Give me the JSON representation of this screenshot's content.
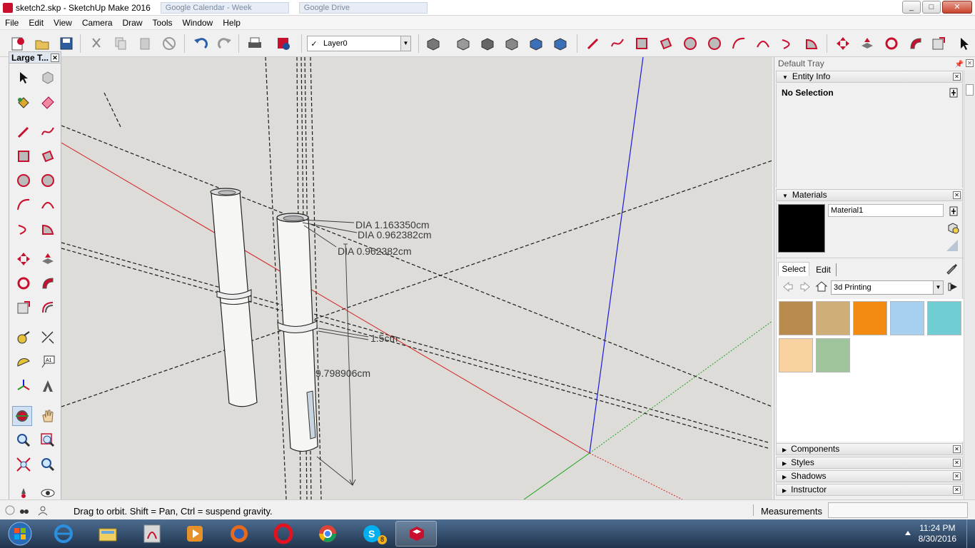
{
  "window": {
    "title": "sketch2.skp - SketchUp Make 2016",
    "ghost_tabs": [
      "Google Calendar - Week",
      "Google Drive"
    ],
    "min_glyph": "_",
    "max_glyph": "□",
    "close_glyph": "✕"
  },
  "menu": [
    "File",
    "Edit",
    "View",
    "Camera",
    "Draw",
    "Tools",
    "Window",
    "Help"
  ],
  "toolbar": {
    "layer_checked": "✓",
    "layer_value": "Layer0",
    "layer_arrow": "▼"
  },
  "palette": {
    "title": "Large T...",
    "close": "✕",
    "text_tool_label": "A1"
  },
  "viewport": {
    "dimensions": [
      "DIA 1.163350cm",
      "DIA 0.962382cm",
      "DIA 0.962382cm",
      "1.5cm",
      "9.798906cm"
    ]
  },
  "tray": {
    "title": "Default Tray",
    "pin": "📌",
    "close": "✕",
    "entity_info": {
      "label": "Entity Info",
      "selection": "No Selection"
    },
    "materials": {
      "label": "Materials",
      "material_name": "Material1",
      "tab_select": "Select",
      "tab_edit": "Edit",
      "collection": "3d Printing",
      "swatch_colors": [
        "#b98a4e",
        "#cfae77",
        "#f28a10",
        "#a7cff0",
        "#6fcdd3",
        "#f9d0a0",
        "#9fc49b"
      ]
    },
    "collapsed_panels": [
      "Components",
      "Styles",
      "Shadows",
      "Instructor"
    ],
    "collapsed_triangle": "▶",
    "expanded_triangle": "▼"
  },
  "statusbar": {
    "hint": "Drag to orbit. Shift = Pan, Ctrl = suspend gravity.",
    "measurements_label": "Measurements"
  },
  "taskbar": {
    "time": "11:24 PM",
    "date": "8/30/2016",
    "skype_badge": "8"
  },
  "colors": {
    "viewport_bg": "#dddcd8",
    "red_axis": "#d42020",
    "blue_axis": "#1a1ad8",
    "green_axis": "#1fa11f",
    "sketchup_red": "#c8102e"
  }
}
